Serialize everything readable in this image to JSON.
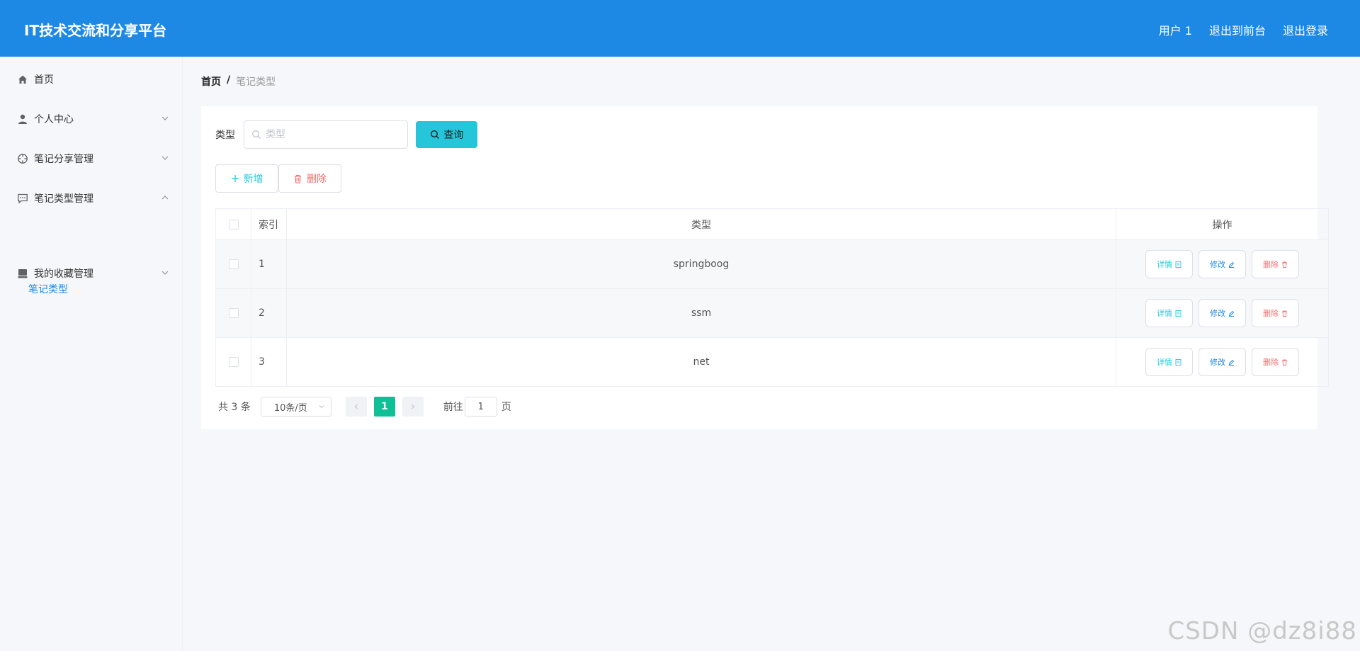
{
  "header": {
    "title": "IT技术交流和分享平台",
    "user": "用户 1",
    "to_front": "退出到前台",
    "logout": "退出登录"
  },
  "sidebar": {
    "items": [
      {
        "label": "首页",
        "icon": "home-icon",
        "has_chevron": false
      },
      {
        "label": "个人中心",
        "icon": "user-icon",
        "chevron": "down"
      },
      {
        "label": "笔记分享管理",
        "icon": "crosshair-icon",
        "chevron": "down"
      },
      {
        "label": "笔记类型管理",
        "icon": "chat-icon",
        "chevron": "up"
      },
      {
        "label": "我的收藏管理",
        "icon": "storage-icon",
        "chevron": "down"
      }
    ],
    "submenu": {
      "label": "笔记类型"
    }
  },
  "breadcrumb": {
    "home": "首页",
    "separator": "/",
    "current": "笔记类型"
  },
  "search": {
    "label": "类型",
    "placeholder": "类型",
    "value": "",
    "button": "查询"
  },
  "actions": {
    "add": "新增",
    "delete": "删除"
  },
  "table": {
    "headers": {
      "index": "索引",
      "type": "类型",
      "ops": "操作"
    },
    "rows": [
      {
        "index": "1",
        "type": "springboog"
      },
      {
        "index": "2",
        "type": "ssm"
      },
      {
        "index": "3",
        "type": "net"
      }
    ],
    "op_labels": {
      "detail": "详情",
      "edit": "修改",
      "delete": "删除"
    }
  },
  "pagination": {
    "total": "共 3 条",
    "page_size": "10条/页",
    "current_page": "1",
    "goto_label": "前往",
    "goto_value": "1",
    "goto_suffix": "页"
  },
  "watermark": "CSDN @dz8i88",
  "colors": {
    "primary": "#1e88e5",
    "accent": "#26c6da",
    "danger": "#f56c6c",
    "pager_active": "#0fc096"
  }
}
